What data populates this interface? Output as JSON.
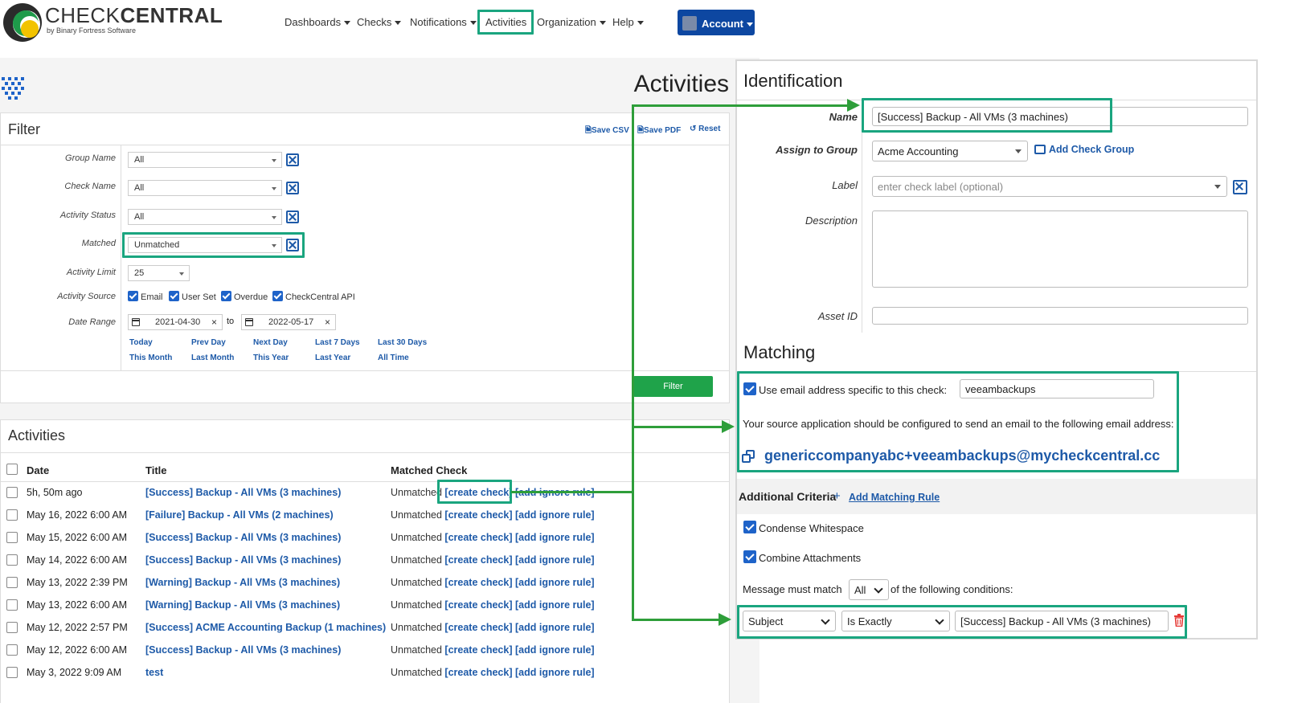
{
  "header": {
    "logo_title_light": "CHECK",
    "logo_title_bold": "CENTRAL",
    "logo_subtitle": "by Binary Fortress Software",
    "nav": [
      "Dashboards",
      "Checks",
      "Notifications",
      "Activities",
      "Organization",
      "Help"
    ],
    "account_label": "Account"
  },
  "page": {
    "title": "Activities"
  },
  "filter": {
    "title": "Filter",
    "save_csv": "Save CSV",
    "save_pdf": "Save PDF",
    "reset": "Reset",
    "group_name_label": "Group Name",
    "group_name_value": "All",
    "check_name_label": "Check Name",
    "check_name_value": "All",
    "activity_status_label": "Activity Status",
    "activity_status_value": "All",
    "matched_label": "Matched",
    "matched_value": "Unmatched",
    "activity_limit_label": "Activity Limit",
    "activity_limit_value": "25",
    "activity_source_label": "Activity Source",
    "sources": [
      "Email",
      "User Set",
      "Overdue",
      "CheckCentral API"
    ],
    "date_range_label": "Date Range",
    "date_from": "2021-04-30",
    "date_to_word": "to",
    "date_to": "2022-05-17",
    "quick_row1": [
      "Today",
      "Prev Day",
      "Next Day",
      "Last 7 Days",
      "Last 30 Days"
    ],
    "quick_row2": [
      "This Month",
      "Last Month",
      "This Year",
      "Last Year",
      "All Time"
    ],
    "filter_button": "Filter"
  },
  "activities": {
    "title": "Activities",
    "columns": [
      "Date",
      "Title",
      "Matched Check"
    ],
    "unmatched": "Unmatched",
    "create_check": "[create check]",
    "add_ignore_rule": "[add ignore rule]",
    "rows": [
      {
        "date": "5h, 50m ago",
        "title": "[Success] Backup - All VMs (3 machines)"
      },
      {
        "date": "May 16, 2022 6:00 AM",
        "title": "[Failure] Backup - All VMs (2 machines)"
      },
      {
        "date": "May 15, 2022 6:00 AM",
        "title": "[Success] Backup - All VMs (3 machines)"
      },
      {
        "date": "May 14, 2022 6:00 AM",
        "title": "[Success] Backup - All VMs (3 machines)"
      },
      {
        "date": "May 13, 2022 2:39 PM",
        "title": "[Warning] Backup - All VMs (3 machines)"
      },
      {
        "date": "May 13, 2022 6:00 AM",
        "title": "[Warning] Backup - All VMs (3 machines)"
      },
      {
        "date": "May 12, 2022 2:57 PM",
        "title": "[Success] ACME Accounting Backup (1 machines)"
      },
      {
        "date": "May 12, 2022 6:00 AM",
        "title": "[Success] Backup - All VMs (3 machines)"
      },
      {
        "date": "May 3, 2022 9:09 AM",
        "title": "test"
      }
    ]
  },
  "identification": {
    "title": "Identification",
    "name_label": "Name",
    "name_value": "[Success] Backup - All VMs (3 machines)",
    "group_label": "Assign to Group",
    "group_value": "Acme Accounting",
    "add_group": "Add Check Group",
    "label_label": "Label",
    "label_placeholder": "enter check label (optional)",
    "description_label": "Description",
    "asset_label": "Asset ID"
  },
  "matching": {
    "title": "Matching",
    "use_email_label": "Use email address specific to this check:",
    "use_email_value": "veeambackups",
    "source_note": "Your source application should be configured to send an email to the following email address:",
    "email_address": "genericcompanyabc+veeambackups@mycheckcentral.cc",
    "additional_criteria": "Additional Criteria",
    "add_matching_rule": "Add Matching Rule",
    "condense_whitespace": "Condense Whitespace",
    "combine_attachments": "Combine Attachments",
    "message_match_prefix": "Message must match",
    "match_mode": "All",
    "message_match_suffix": "of the following conditions:",
    "rule_field": "Subject",
    "rule_operator": "Is Exactly",
    "rule_value": "[Success] Backup - All VMs (3 machines)"
  },
  "colors": {
    "highlight": "#1aa57f",
    "arrow": "#2e9e3a",
    "link": "#1e5aa8",
    "account_bg": "#0d47a1",
    "filter_btn": "#1fa34a"
  }
}
